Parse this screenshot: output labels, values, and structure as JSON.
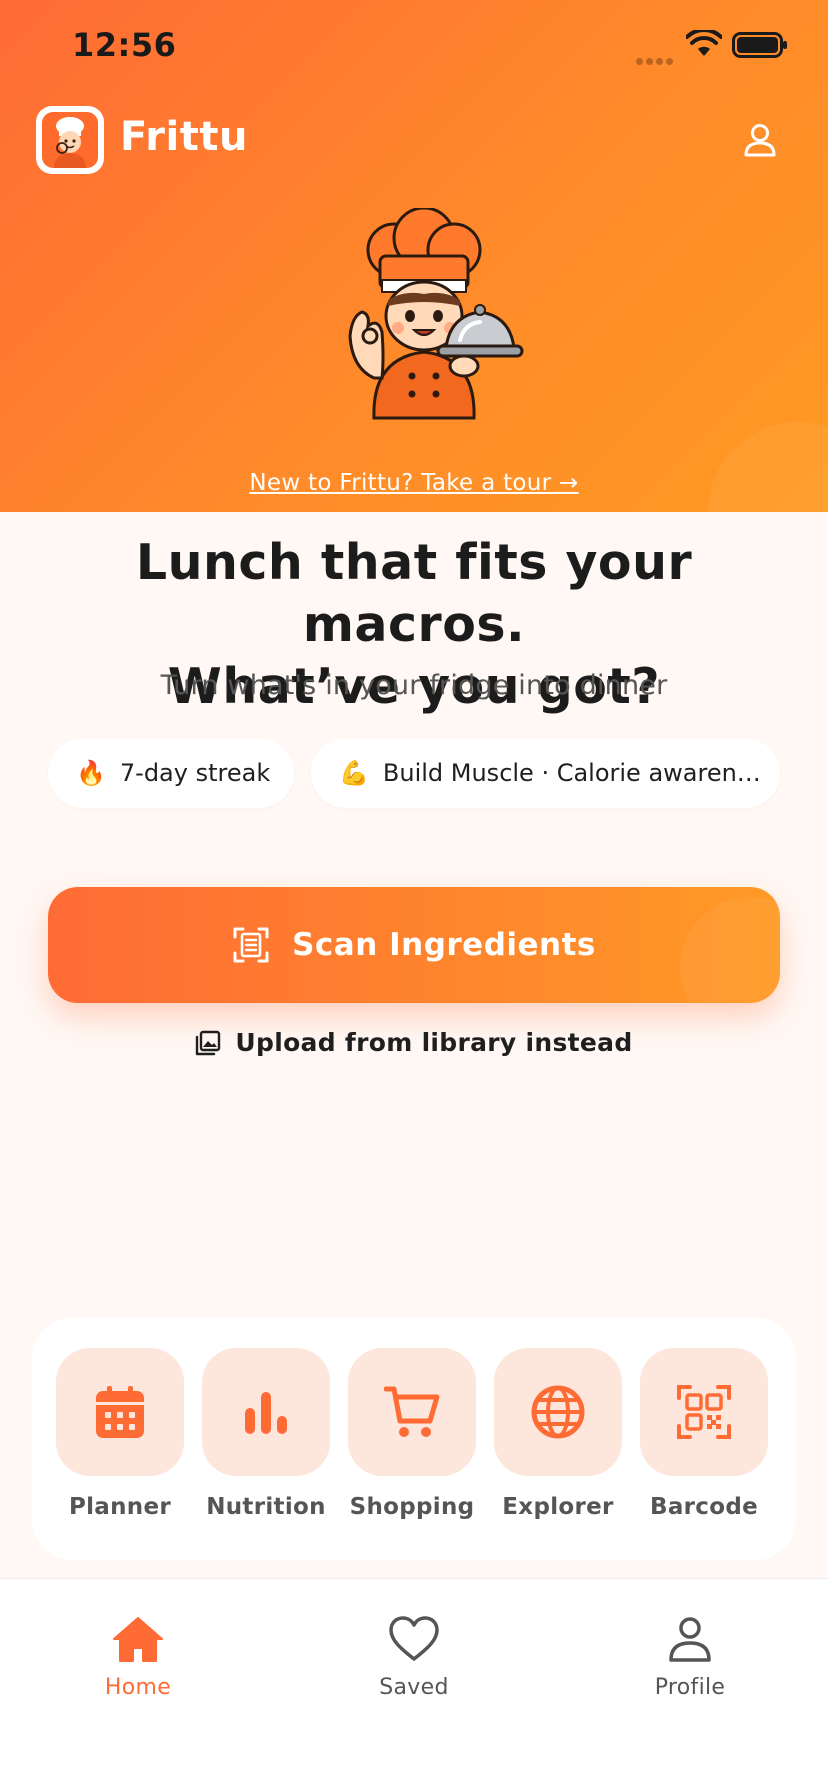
{
  "status_bar": {
    "time": "12:56"
  },
  "header": {
    "app_name": "Frittu",
    "logo_icon": "chef-mascot-logo",
    "account_icon": "user-icon"
  },
  "hero": {
    "mascot": "chef-holding-cloche",
    "tour_link": "New to Frittu? Take a tour →"
  },
  "main": {
    "headline_line1": "Lunch that fits your macros.",
    "headline_line2": "What’ve you got?",
    "subheadline": "Turn what's in your fridge into dinner",
    "chips": [
      {
        "emoji": "🔥",
        "label": "7-day streak"
      },
      {
        "emoji": "💪",
        "label": "Build Muscle · Calorie awaren…"
      }
    ],
    "scan_button": {
      "label": "Scan Ingredients",
      "icon": "scan-document-icon"
    },
    "upload_link": {
      "label": "Upload from library instead",
      "icon": "photo-library-icon"
    }
  },
  "tools": [
    {
      "label": "Planner",
      "icon": "calendar-icon"
    },
    {
      "label": "Nutrition",
      "icon": "bar-chart-icon"
    },
    {
      "label": "Shopping",
      "icon": "cart-icon"
    },
    {
      "label": "Explorer",
      "icon": "globe-icon"
    },
    {
      "label": "Barcode",
      "icon": "qr-code-icon"
    }
  ],
  "tabbar": {
    "tabs": [
      {
        "label": "Home",
        "icon": "home-icon",
        "active": true
      },
      {
        "label": "Saved",
        "icon": "heart-icon",
        "active": false
      },
      {
        "label": "Profile",
        "icon": "profile-icon",
        "active": false
      }
    ]
  },
  "colors": {
    "brand_orange": "#ff6b35",
    "brand_orange_light": "#ff9a22",
    "tile_bg": "#fde6dc",
    "page_bg": "#fff8f4"
  }
}
